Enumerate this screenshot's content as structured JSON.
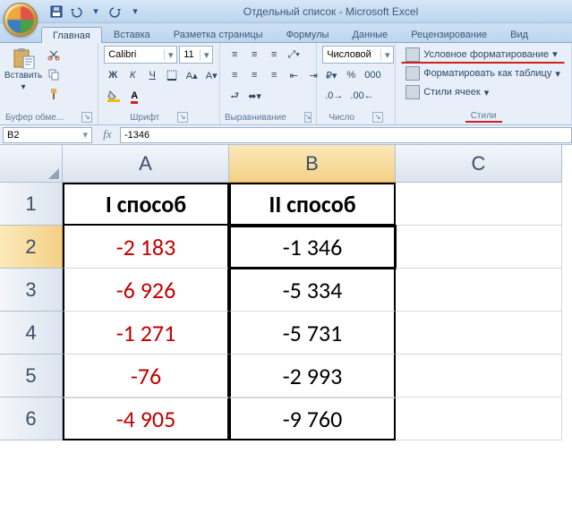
{
  "title": "Отдельный список - Microsoft Excel",
  "qat": {
    "save": "save",
    "undo": "undo",
    "redo": "redo"
  },
  "tabs": [
    "Главная",
    "Вставка",
    "Разметка страницы",
    "Формулы",
    "Данные",
    "Рецензирование",
    "Вид"
  ],
  "active_tab": 0,
  "ribbon": {
    "clipboard": {
      "paste": "Вставить",
      "label": "Буфер обме..."
    },
    "font": {
      "name": "Calibri",
      "size": "11",
      "bold": "Ж",
      "italic": "К",
      "underline": "Ч",
      "label": "Шрифт"
    },
    "alignment": {
      "label": "Выравнивание"
    },
    "number": {
      "format": "Числовой",
      "label": "Число"
    },
    "styles": {
      "conditional": "Условное форматирование",
      "format_table": "Форматировать как таблицу",
      "cell_styles": "Стили ячеек",
      "label": "Стили"
    }
  },
  "name_box": "B2",
  "formula": "-1346",
  "columns": [
    "A",
    "B",
    "C"
  ],
  "selected_col": 1,
  "rows": [
    {
      "n": "1",
      "a": "I способ",
      "b": "II способ",
      "c": "",
      "header": true
    },
    {
      "n": "2",
      "a": "-2 183",
      "b": "-1 346",
      "c": ""
    },
    {
      "n": "3",
      "a": "-6 926",
      "b": "-5 334",
      "c": ""
    },
    {
      "n": "4",
      "a": "-1 271",
      "b": "-5 731",
      "c": ""
    },
    {
      "n": "5",
      "a": "-76",
      "b": "-2 993",
      "c": ""
    },
    {
      "n": "6",
      "a": "-4 905",
      "b": "-9 760",
      "c": ""
    }
  ],
  "active_cell": "B2",
  "chart_data": {
    "type": "table",
    "title": "",
    "columns": [
      "I способ",
      "II способ"
    ],
    "data": [
      [
        -2183,
        -1346
      ],
      [
        -6926,
        -5334
      ],
      [
        -1271,
        -5731
      ],
      [
        -76,
        -2993
      ],
      [
        -4905,
        -9760
      ]
    ]
  }
}
